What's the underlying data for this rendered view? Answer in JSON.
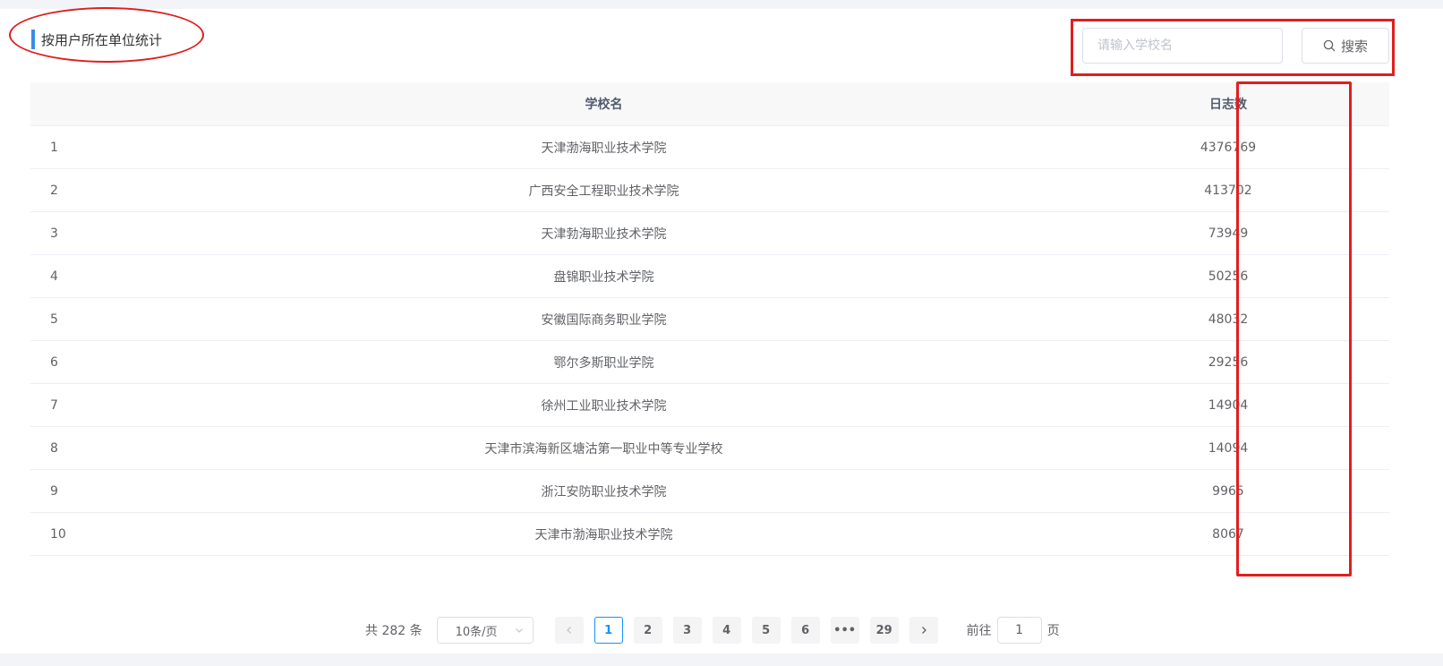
{
  "header": {
    "title": "按用户所在单位统计"
  },
  "search": {
    "placeholder": "请输入学校名",
    "button_label": "搜索"
  },
  "table": {
    "columns": {
      "index": "",
      "name": "学校名",
      "count": "日志数"
    },
    "rows": [
      {
        "index": "1",
        "name": "天津渤海职业技术学院",
        "count": "4376769"
      },
      {
        "index": "2",
        "name": "广西安全工程职业技术学院",
        "count": "413702"
      },
      {
        "index": "3",
        "name": "天津勃海职业技术学院",
        "count": "73949"
      },
      {
        "index": "4",
        "name": "盘锦职业技术学院",
        "count": "50256"
      },
      {
        "index": "5",
        "name": "安徽国际商务职业学院",
        "count": "48032"
      },
      {
        "index": "6",
        "name": "鄂尔多斯职业学院",
        "count": "29256"
      },
      {
        "index": "7",
        "name": "徐州工业职业技术学院",
        "count": "14904"
      },
      {
        "index": "8",
        "name": "天津市滨海新区塘沽第一职业中等专业学校",
        "count": "14094"
      },
      {
        "index": "9",
        "name": "浙江安防职业技术学院",
        "count": "9965"
      },
      {
        "index": "10",
        "name": "天津市渤海职业技术学院",
        "count": "8067"
      }
    ]
  },
  "pagination": {
    "total": "共 282 条",
    "page_size": "10条/页",
    "pages": [
      "1",
      "2",
      "3",
      "4",
      "5",
      "6",
      "•••",
      "29"
    ],
    "goto_prefix": "前往",
    "goto_value": "1",
    "goto_suffix": "页"
  },
  "colors": {
    "accent": "#3a8ee6",
    "annotation": "#e01e1e",
    "active_page": "#1890ff"
  }
}
